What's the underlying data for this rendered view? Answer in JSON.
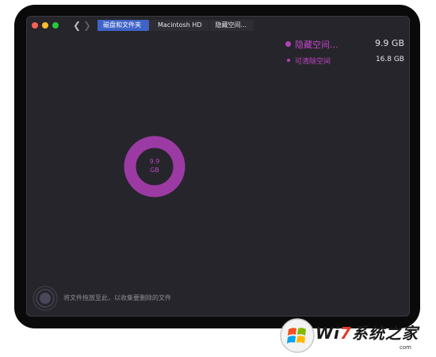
{
  "toolbar": {
    "back_icon": "chevron-left",
    "forward_icon": "chevron-right",
    "breadcrumbs": [
      "磁盘和文件夹",
      "Macintosh HD",
      "隐藏空间..."
    ]
  },
  "legend": [
    {
      "label": "隐藏空间...",
      "value": "9.9 GB",
      "color": "#b042b8"
    },
    {
      "label": "可清除空间",
      "value": "16.8 GB",
      "color": "#b042b8"
    }
  ],
  "ring": {
    "line1": "9.9",
    "line2": "GB",
    "color": "#9b3aa3",
    "fraction": 1.0
  },
  "dropzone": {
    "text": "将文件拖放至此，以收集要删除的文件",
    "icon": "drop-target-icon"
  },
  "watermark": {
    "brand_prefix": "Wi",
    "brand_seven": "7",
    "brand_suffix": "系统之家",
    "sub": "com"
  }
}
